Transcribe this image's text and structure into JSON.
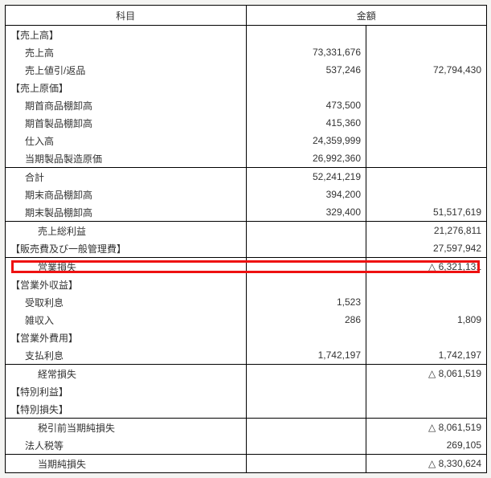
{
  "headers": {
    "item": "科目",
    "amount": "金額"
  },
  "rows": [
    {
      "label": "【売上高】",
      "indent": 0,
      "col1": "",
      "col2": "",
      "top": false
    },
    {
      "label": "売上高",
      "indent": 1,
      "col1": "73,331,676",
      "col2": "",
      "top": false
    },
    {
      "label": "売上値引/返品",
      "indent": 1,
      "col1": "537,246",
      "col2": "72,794,430",
      "top": false
    },
    {
      "label": "【売上原価】",
      "indent": 0,
      "col1": "",
      "col2": "",
      "top": false
    },
    {
      "label": "期首商品棚卸高",
      "indent": 1,
      "col1": "473,500",
      "col2": "",
      "top": false
    },
    {
      "label": "期首製品棚卸高",
      "indent": 1,
      "col1": "415,360",
      "col2": "",
      "top": false
    },
    {
      "label": "仕入高",
      "indent": 1,
      "col1": "24,359,999",
      "col2": "",
      "top": false
    },
    {
      "label": "当期製品製造原価",
      "indent": 1,
      "col1": "26,992,360",
      "col2": "",
      "top": false
    },
    {
      "label": "合計",
      "indent": 1,
      "col1": "52,241,219",
      "col2": "",
      "top": true
    },
    {
      "label": "期末商品棚卸高",
      "indent": 1,
      "col1": "394,200",
      "col2": "",
      "top": false
    },
    {
      "label": "期末製品棚卸高",
      "indent": 1,
      "col1": "329,400",
      "col2": "51,517,619",
      "top": false
    },
    {
      "label": "売上総利益",
      "indent": 2,
      "col1": "",
      "col2": "21,276,811",
      "top": true
    },
    {
      "label": "【販売費及び一般管理費】",
      "indent": 0,
      "col1": "",
      "col2": "27,597,942",
      "top": false
    },
    {
      "label": "営業損失",
      "indent": 2,
      "col1": "",
      "col2": "△ 6,321,131",
      "top": true,
      "highlight": true
    },
    {
      "label": "【営業外収益】",
      "indent": 0,
      "col1": "",
      "col2": "",
      "top": false
    },
    {
      "label": "受取利息",
      "indent": 1,
      "col1": "1,523",
      "col2": "",
      "top": false
    },
    {
      "label": "雑収入",
      "indent": 1,
      "col1": "286",
      "col2": "1,809",
      "top": false
    },
    {
      "label": "【営業外費用】",
      "indent": 0,
      "col1": "",
      "col2": "",
      "top": false
    },
    {
      "label": "支払利息",
      "indent": 1,
      "col1": "1,742,197",
      "col2": "1,742,197",
      "top": false
    },
    {
      "label": "経常損失",
      "indent": 2,
      "col1": "",
      "col2": "△ 8,061,519",
      "top": true
    },
    {
      "label": "【特別利益】",
      "indent": 0,
      "col1": "",
      "col2": "",
      "top": false
    },
    {
      "label": "【特別損失】",
      "indent": 0,
      "col1": "",
      "col2": "",
      "top": false
    },
    {
      "label": "税引前当期純損失",
      "indent": 2,
      "col1": "",
      "col2": "△ 8,061,519",
      "top": true
    },
    {
      "label": "法人税等",
      "indent": 1,
      "col1": "",
      "col2": "269,105",
      "top": false
    },
    {
      "label": "当期純損失",
      "indent": 2,
      "col1": "",
      "col2": "△ 8,330,624",
      "top": true
    }
  ]
}
